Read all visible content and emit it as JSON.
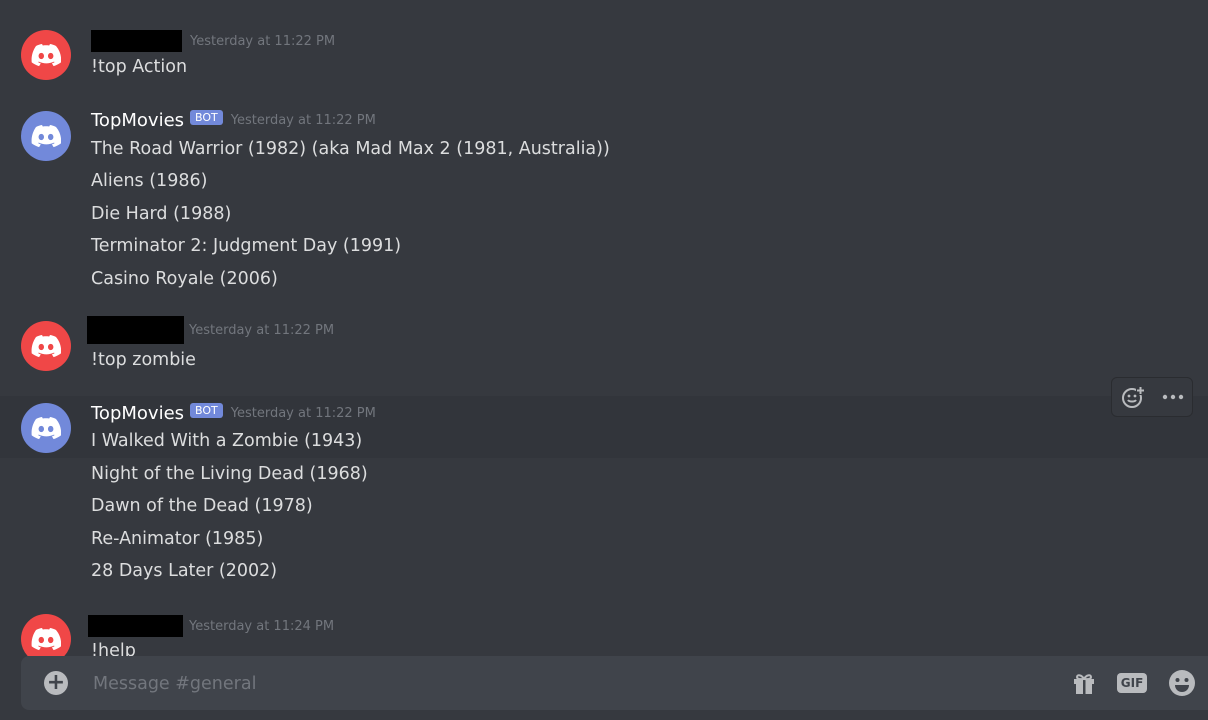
{
  "messages": [
    {
      "author_redacted": true,
      "timestamp": "Yesterday at 11:22 PM",
      "lines": [
        "!top Action"
      ]
    },
    {
      "author": "TopMovies",
      "bot_tag": "BOT",
      "timestamp": "Yesterday at 11:22 PM",
      "lines": [
        "The Road Warrior (1982) (aka Mad Max 2 (1981, Australia))",
        "Aliens (1986)",
        "Die Hard (1988)",
        "Terminator 2: Judgment Day (1991)",
        "Casino Royale (2006)"
      ]
    },
    {
      "author_redacted": true,
      "timestamp": "Yesterday at 11:22 PM",
      "lines": [
        "!top zombie"
      ]
    },
    {
      "author": "TopMovies",
      "bot_tag": "BOT",
      "timestamp": "Yesterday at 11:22 PM",
      "lines": [
        "I Walked With a Zombie (1943)",
        "Night of the Living Dead (1968)",
        "Dawn of the Dead (1978)",
        "Re-Animator (1985)",
        "28 Days Later (2002)"
      ]
    },
    {
      "author_redacted": true,
      "timestamp": "Yesterday at 11:24 PM",
      "lines": [
        "!help"
      ]
    }
  ],
  "hover_toolbar": {
    "icons": [
      "add-reaction-icon",
      "more-options-icon"
    ]
  },
  "composer": {
    "placeholder": "Message #general",
    "value": "",
    "gif_label": "GIF",
    "icons": [
      "plus-circle-icon",
      "gift-icon",
      "gif-icon",
      "emoji-icon"
    ]
  },
  "colors": {
    "background": "#36393f",
    "user_avatar": "#f04747",
    "bot_avatar": "#7289da",
    "bot_tag": "#7289da",
    "timestamp": "#72767d",
    "composer": "#40444b"
  }
}
